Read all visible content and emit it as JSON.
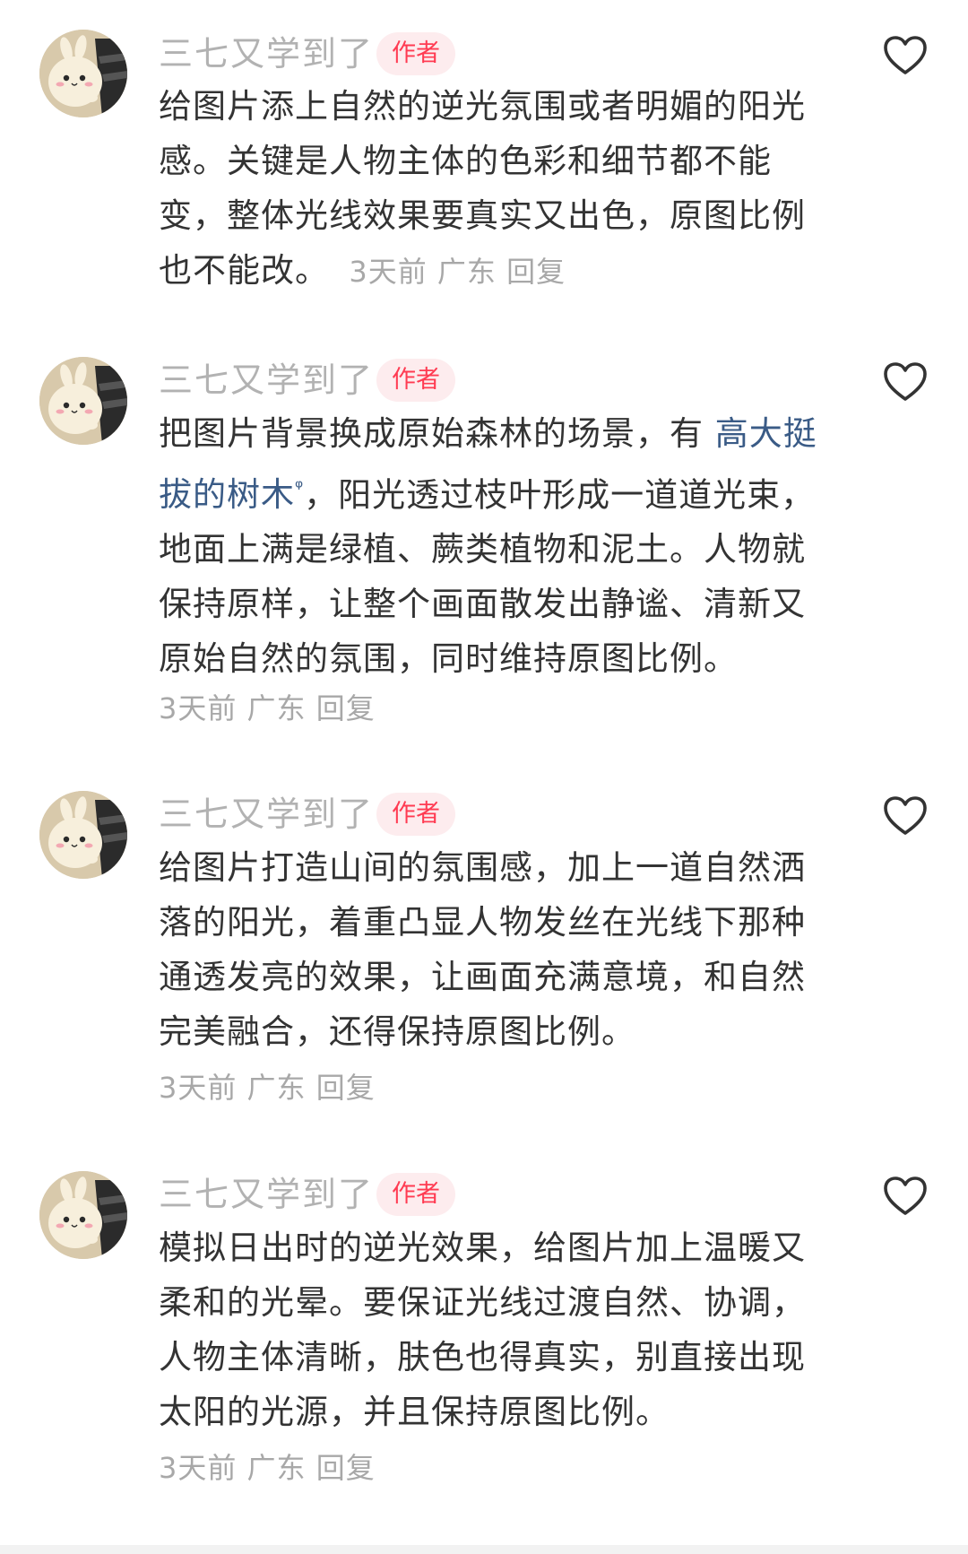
{
  "comments": [
    {
      "username": "三七又学到了",
      "badge": "作者",
      "text": "给图片添上自然的逆光氛围或者明媚的阳光感。关键是人物主体的色彩和细节都不能变，整体光线效果要真实又出色，原图比例也不能改。",
      "time": "3天前",
      "location": "广东",
      "reply": "回复"
    },
    {
      "username": "三七又学到了",
      "badge": "作者",
      "text_before": "把图片背景换成原始森林的场景，有 ",
      "link": "高大挺拔的树木",
      "link_mark": "ᵠ",
      "text_after": "，阳光透过枝叶形成一道道光束，地面上满是绿植、蕨类植物和泥土。人物就保持原样，让整个画面散发出静谧、清新又原始自然的氛围，同时维持原图比例。",
      "time": "3天前",
      "location": "广东",
      "reply": "回复"
    },
    {
      "username": "三七又学到了",
      "badge": "作者",
      "text": "给图片打造山间的氛围感，加上一道自然洒落的阳光，着重凸显人物发丝在光线下那种通透发亮的效果，让画面充满意境，和自然完美融合，还得保持原图比例。",
      "time": "3天前",
      "location": "广东",
      "reply": "回复"
    },
    {
      "username": "三七又学到了",
      "badge": "作者",
      "text": "模拟日出时的逆光效果，给图片加上温暖又柔和的光晕。要保证光线过渡自然、协调，人物主体清晰，肤色也得真实，别直接出现太阳的光源，并且保持原图比例。",
      "time": "3天前",
      "location": "广东",
      "reply": "回复"
    }
  ],
  "icons": {
    "like": "heart-outline-icon",
    "avatar": "bunny-avatar"
  },
  "colors": {
    "username": "#b2b2b2",
    "badge_text": "#ff3b52",
    "badge_bg": "#fdecee",
    "link": "#3a5b86",
    "meta": "#a8a8a8",
    "body": "#333333"
  }
}
